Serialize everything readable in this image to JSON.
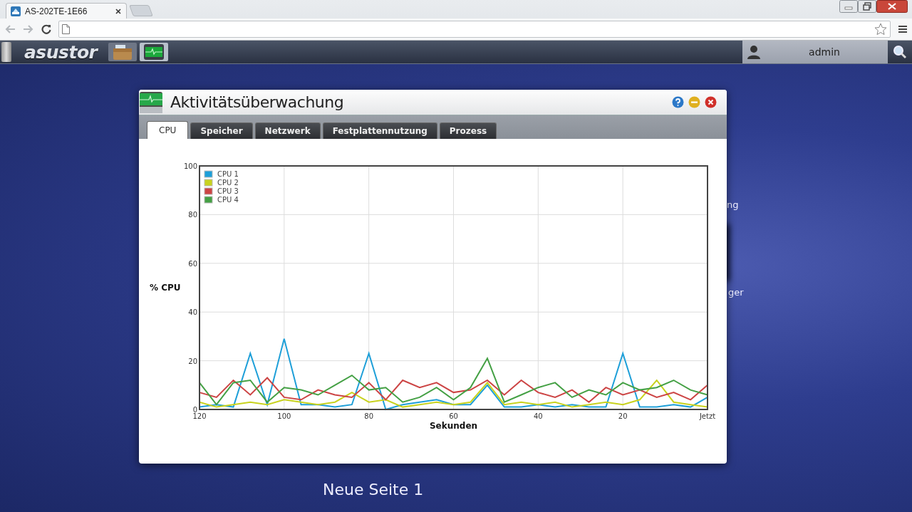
{
  "browser": {
    "tab_title": "AS-202TE-1E66"
  },
  "nas_bar": {
    "logo": "asustor",
    "user": "admin"
  },
  "desktop_labels": [
    "ng",
    "ger",
    "Neue Seite 1"
  ],
  "window": {
    "title": "Aktivitätsüberwachung",
    "tabs": [
      {
        "label": "CPU",
        "selected": true
      },
      {
        "label": "Speicher",
        "selected": false
      },
      {
        "label": "Netzwerk",
        "selected": false
      },
      {
        "label": "Festplattennutzung",
        "selected": false
      },
      {
        "label": "Prozess",
        "selected": false
      }
    ],
    "chart_data": {
      "type": "line",
      "xlabel": "Sekunden",
      "ylabel": "% CPU",
      "x": [
        120,
        116,
        112,
        108,
        104,
        100,
        96,
        92,
        88,
        84,
        80,
        76,
        72,
        68,
        64,
        60,
        56,
        52,
        48,
        44,
        40,
        36,
        32,
        28,
        24,
        20,
        16,
        12,
        8,
        4,
        0
      ],
      "xlim": [
        120,
        0
      ],
      "ylim": [
        0,
        100
      ],
      "xticks": [
        120,
        100,
        80,
        60,
        40,
        20,
        {
          "value": 0,
          "label": "Jetzt"
        }
      ],
      "yticks": [
        0,
        20,
        40,
        60,
        80,
        100
      ],
      "grid": true,
      "legend": true,
      "series": [
        {
          "name": "CPU 1",
          "color": "#1e9fd8",
          "values": [
            1,
            2,
            1,
            23,
            2,
            29,
            2,
            2,
            1,
            2,
            23,
            0,
            2,
            3,
            4,
            2,
            2,
            10,
            1,
            1,
            2,
            1,
            2,
            1,
            1,
            23,
            1,
            1,
            2,
            1,
            5
          ]
        },
        {
          "name": "CPU 2",
          "color": "#c8d21e",
          "values": [
            3,
            1,
            2,
            3,
            2,
            4,
            3,
            2,
            3,
            7,
            3,
            4,
            1,
            2,
            3,
            2,
            3,
            11,
            2,
            3,
            2,
            3,
            1,
            2,
            3,
            2,
            4,
            12,
            3,
            2,
            1
          ]
        },
        {
          "name": "CPU 3",
          "color": "#cc4444",
          "values": [
            7,
            5,
            12,
            6,
            13,
            5,
            4,
            8,
            6,
            5,
            11,
            4,
            12,
            9,
            11,
            7,
            8,
            12,
            6,
            12,
            7,
            5,
            8,
            3,
            9,
            6,
            8,
            5,
            7,
            4,
            10
          ]
        },
        {
          "name": "CPU 4",
          "color": "#44a044",
          "values": [
            11,
            2,
            11,
            12,
            3,
            9,
            8,
            6,
            10,
            14,
            8,
            9,
            3,
            5,
            9,
            4,
            9,
            21,
            3,
            6,
            9,
            11,
            5,
            8,
            6,
            11,
            8,
            9,
            12,
            8,
            6
          ]
        }
      ]
    }
  }
}
